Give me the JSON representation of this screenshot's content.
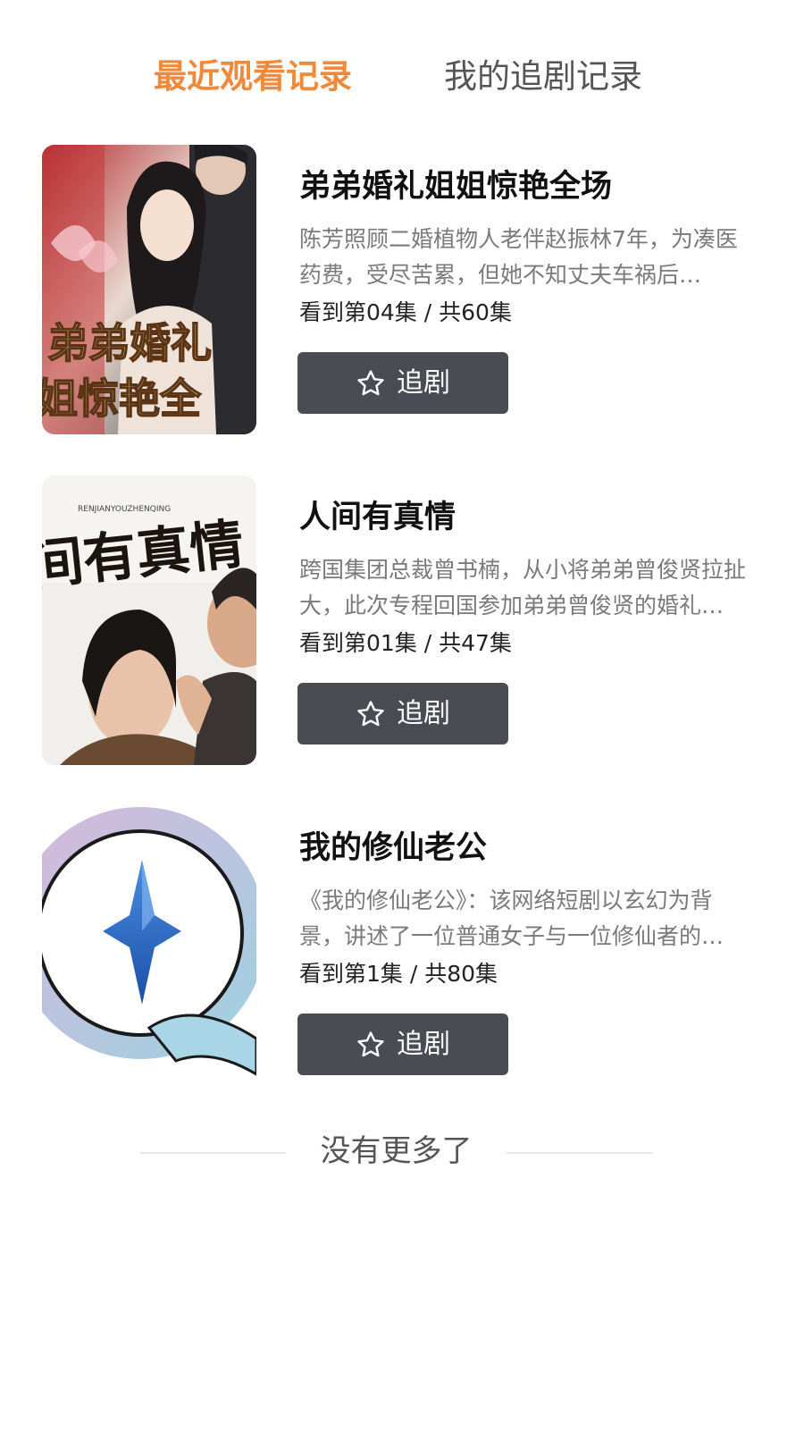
{
  "tabs": {
    "recent": "最近观看记录",
    "following": "我的追剧记录"
  },
  "accent_color": "#ef8a3c",
  "items": [
    {
      "title": "弟弟婚礼姐姐惊艳全场",
      "description": "陈芳照顾二婚植物人老伴赵振林7年，为凑医药费，受尽苦累，但她不知丈夫车祸后…",
      "progress": "看到第04集 / 共60集",
      "follow_label": "追剧",
      "poster_text": "弟弟婚礼姐姐惊艳全场",
      "follow_icon": "star-icon"
    },
    {
      "title": "人间有真情",
      "description": "跨国集团总裁曾书楠，从小将弟弟曾俊贤拉扯大，此次专程回国参加弟弟曾俊贤的婚礼…",
      "progress": "看到第01集 / 共47集",
      "follow_label": "追剧",
      "poster_text": "人间有真情",
      "poster_subtext": "RENJIANYOUZHENQING",
      "follow_icon": "star-icon"
    },
    {
      "title": "我的修仙老公",
      "description": "《我的修仙老公》：该网络短剧以玄幻为背景，讲述了一位普通女子与一位修仙者的故事…",
      "progress": "看到第1集 / 共80集",
      "follow_label": "追剧",
      "follow_icon": "star-icon"
    }
  ],
  "end_text": "没有更多了",
  "button_color": "#4a4c54"
}
